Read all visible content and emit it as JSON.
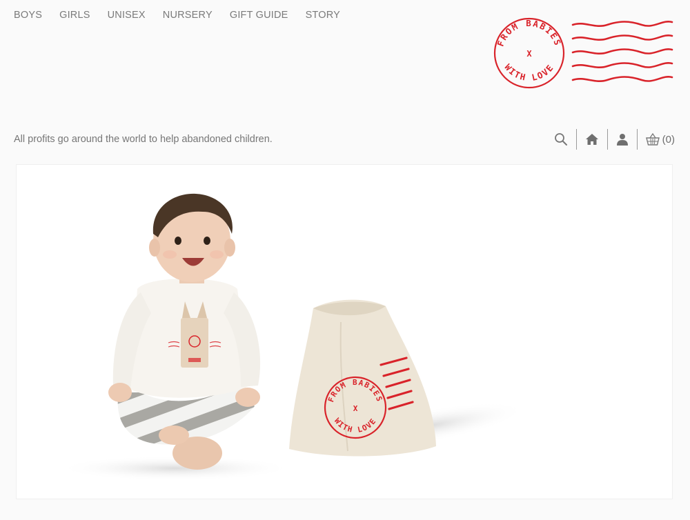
{
  "nav": {
    "items": [
      "BOYS",
      "GIRLS",
      "UNISEX",
      "NURSERY",
      "GIFT GUIDE",
      "STORY"
    ]
  },
  "logo": {
    "text_top": "FROM BABIES",
    "text_center": "X",
    "text_bottom": "WITH LOVE",
    "color": "#d9232a"
  },
  "tagline": "All profits go around the world to help abandoned children.",
  "utilities": {
    "cart_count": "(0)",
    "icons": [
      "search-icon",
      "home-icon",
      "user-icon",
      "basket-icon"
    ]
  },
  "hero": {
    "bag_stamp_top": "FROM BABIES",
    "bag_stamp_center": "X",
    "bag_stamp_bottom": "WITH LOVE",
    "accent": "#d9232a"
  }
}
